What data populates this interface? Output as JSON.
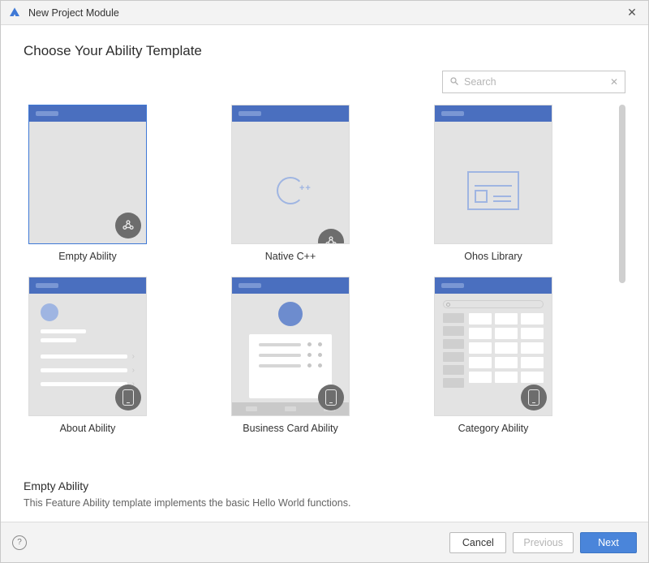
{
  "window": {
    "title": "New Project Module"
  },
  "heading": "Choose Your Ability Template",
  "search": {
    "placeholder": "Search"
  },
  "templates": [
    {
      "label": "Empty Ability",
      "selected": true,
      "badge": "atoms"
    },
    {
      "label": "Native C++",
      "selected": false,
      "badge": "atoms"
    },
    {
      "label": "Ohos Library",
      "selected": false,
      "badge": null
    },
    {
      "label": "About Ability",
      "selected": false,
      "badge": "phone"
    },
    {
      "label": "Business Card Ability",
      "selected": false,
      "badge": "phone"
    },
    {
      "label": "Category Ability",
      "selected": false,
      "badge": "phone"
    }
  ],
  "description": {
    "title": "Empty Ability",
    "text": "This Feature Ability template implements the basic Hello World functions."
  },
  "footer": {
    "cancel": "Cancel",
    "previous": "Previous",
    "next": "Next"
  }
}
